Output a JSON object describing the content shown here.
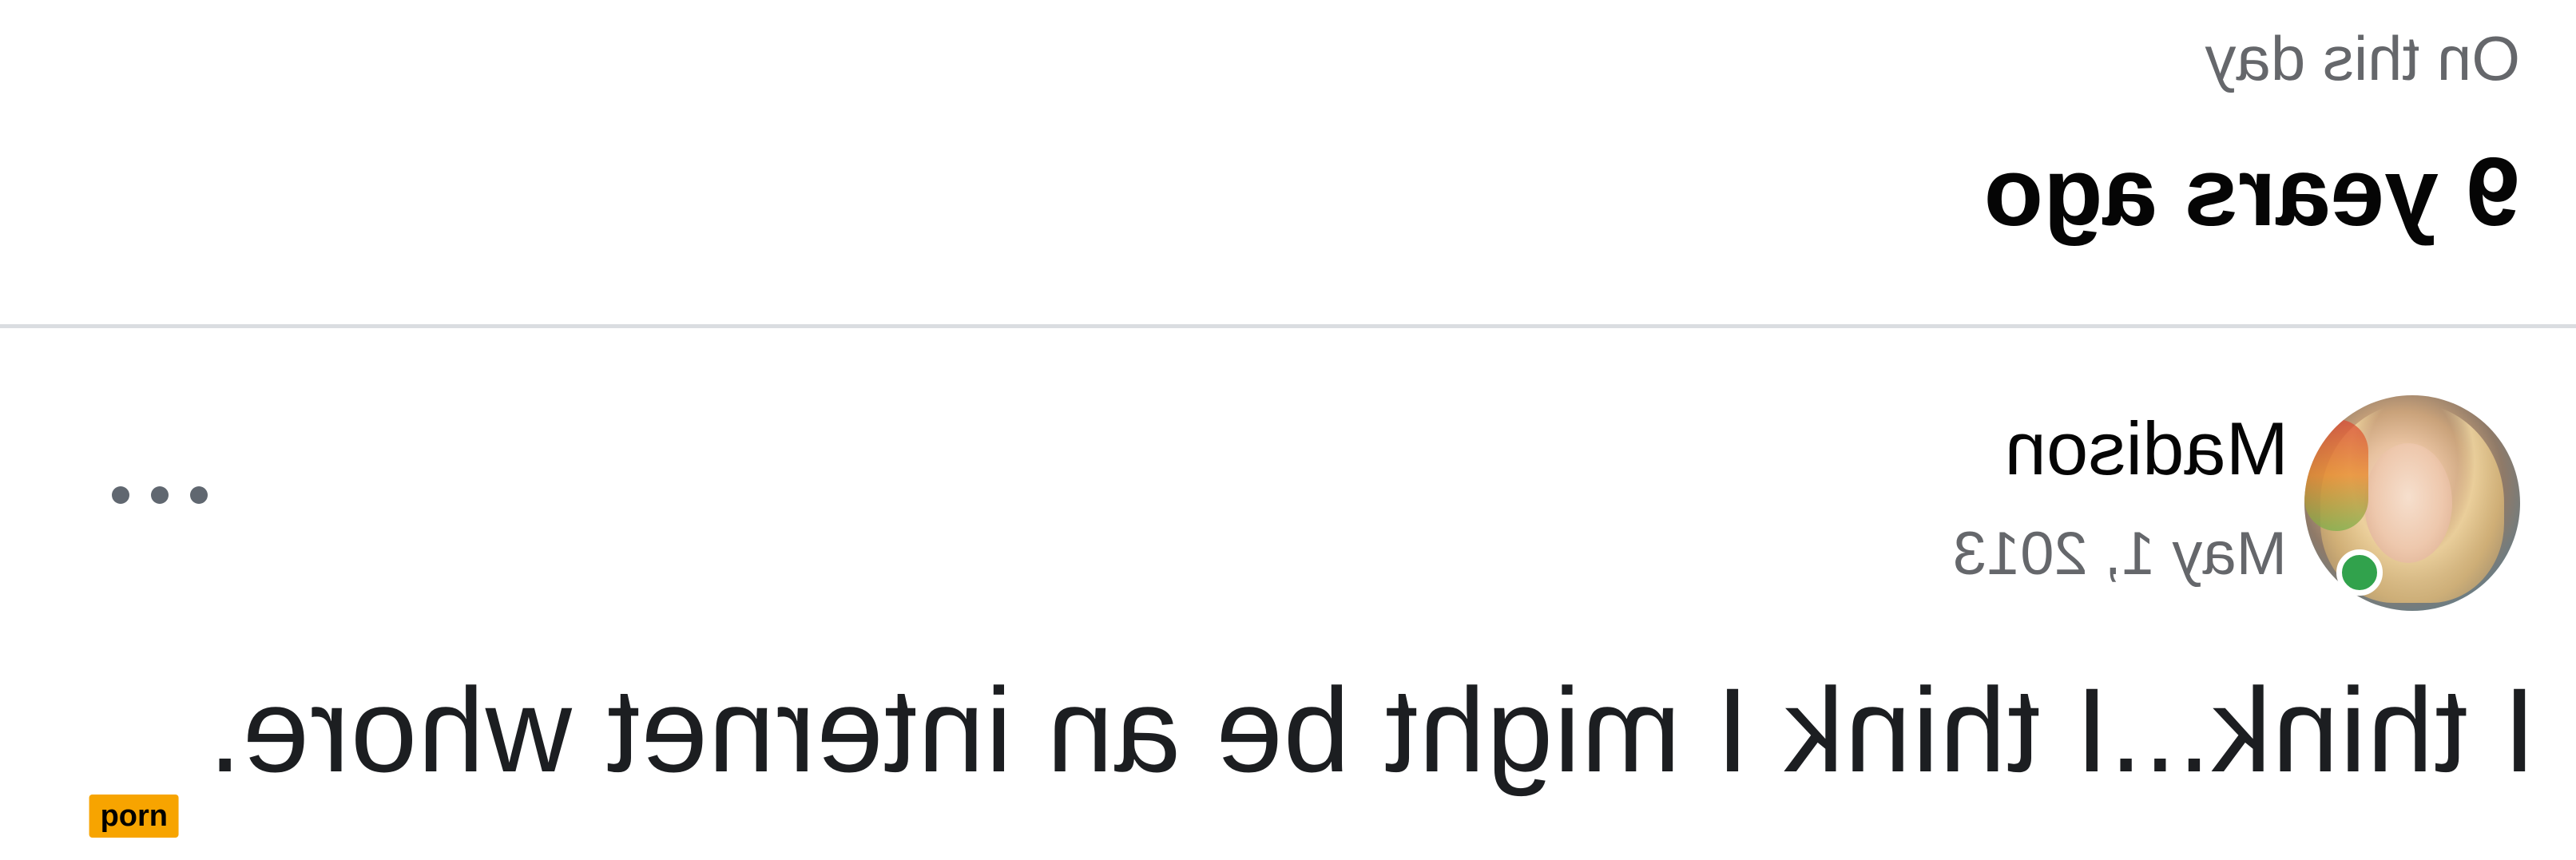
{
  "memory": {
    "subtitle": "On this day",
    "title": "9 years ago"
  },
  "post": {
    "author": "Madison",
    "date": "May 1, 2013",
    "online": true,
    "text": "I think...I think I might be an internet whore.",
    "more_icon": "more-horizontal-icon"
  },
  "watermark": {
    "label": "porn"
  },
  "colors": {
    "online_status": "#31a24c",
    "secondary_text": "#65676b",
    "badge": "#f7a400",
    "divider": "#dadde1"
  }
}
